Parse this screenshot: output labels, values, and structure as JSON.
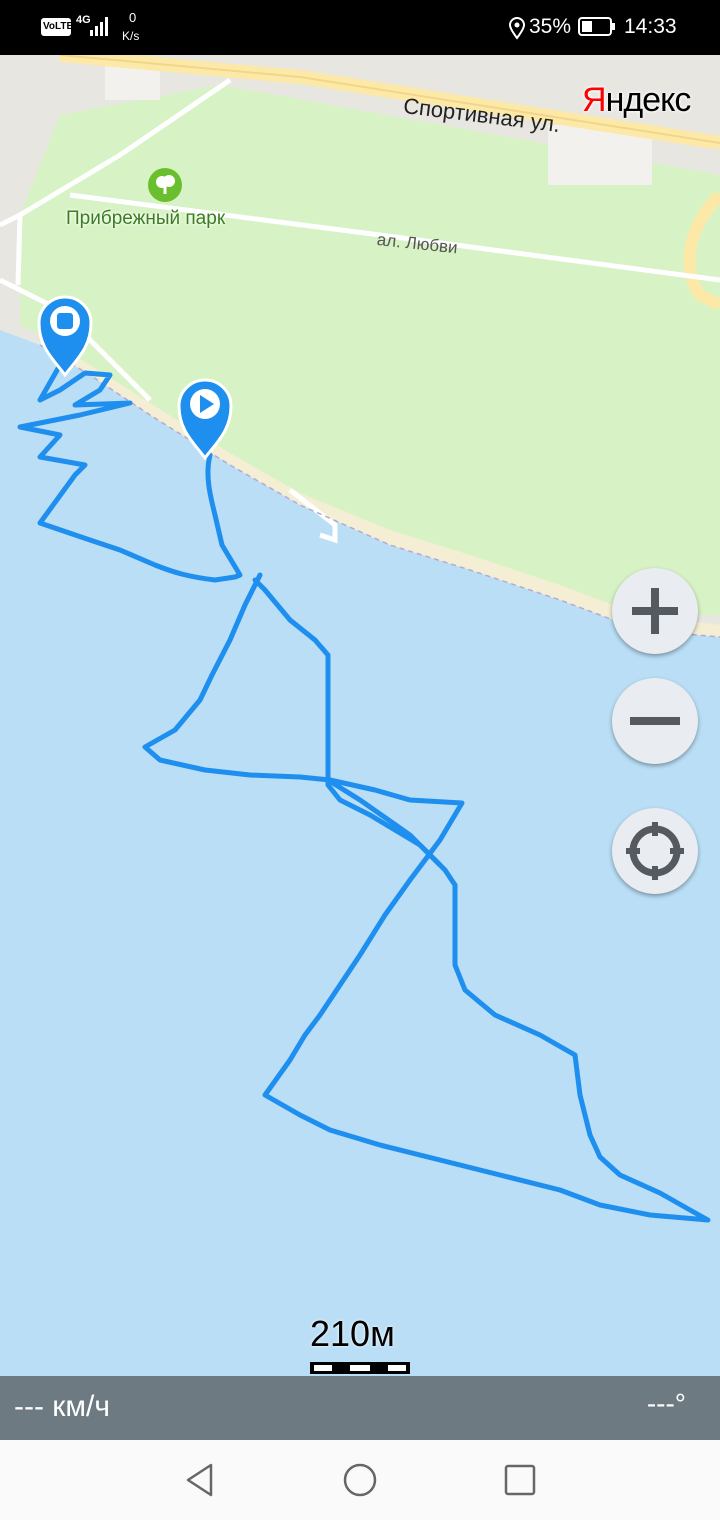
{
  "status_bar": {
    "volte": "VoLTE",
    "network": "4G",
    "speed_value": "0",
    "speed_unit": "K/s",
    "battery": "35%",
    "time": "14:33"
  },
  "map": {
    "brand": "Яндекс",
    "labels": {
      "street_sportivnaya": "Спортивная ул.",
      "park": "Прибрежный парк",
      "alley": "ал. Любви"
    },
    "icons": {
      "park": "tree-icon",
      "start": "play-icon",
      "finish": "stop-icon",
      "zoom_in": "plus-icon",
      "zoom_out": "minus-icon",
      "locate": "crosshair-icon"
    },
    "scale_label": "210м",
    "colors": {
      "water": "#b9def5",
      "park": "#d7f2c4",
      "track": "#1e8fef",
      "road": "#fde9a7"
    }
  },
  "info_bar": {
    "speed": "--- км/ч",
    "heading": "---°"
  },
  "nav_bar": {
    "back": "back-triangle-icon",
    "home": "home-circle-icon",
    "recent": "recent-square-icon"
  }
}
